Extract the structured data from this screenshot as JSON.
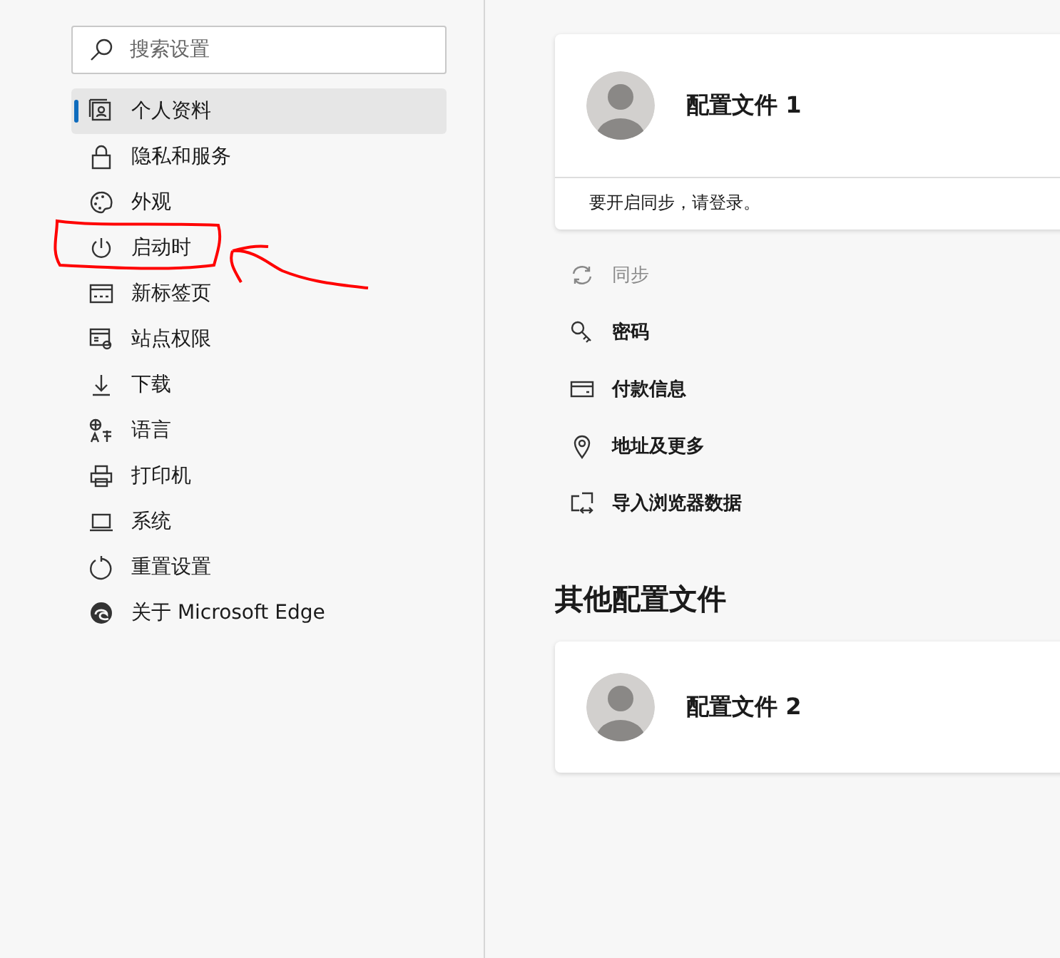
{
  "sidebar": {
    "search": {
      "placeholder": "搜索设置"
    },
    "items": [
      {
        "label": "个人资料",
        "selected": true
      },
      {
        "label": "隐私和服务",
        "selected": false
      },
      {
        "label": "外观",
        "selected": false
      },
      {
        "label": "启动时",
        "selected": false
      },
      {
        "label": "新标签页",
        "selected": false
      },
      {
        "label": "站点权限",
        "selected": false
      },
      {
        "label": "下载",
        "selected": false
      },
      {
        "label": "语言",
        "selected": false
      },
      {
        "label": "打印机",
        "selected": false
      },
      {
        "label": "系统",
        "selected": false
      },
      {
        "label": "重置设置",
        "selected": false
      },
      {
        "label": "关于 Microsoft Edge",
        "selected": false
      }
    ]
  },
  "current_profile": {
    "name": "配置文件 1",
    "footer": "要开启同步，请登录。"
  },
  "profile_options": [
    {
      "label": "同步",
      "disabled": true
    },
    {
      "label": "密码",
      "disabled": false
    },
    {
      "label": "付款信息",
      "disabled": false
    },
    {
      "label": "地址及更多",
      "disabled": false
    },
    {
      "label": "导入浏览器数据",
      "disabled": false
    }
  ],
  "other_profiles": {
    "title": "其他配置文件",
    "profiles": [
      {
        "name": "配置文件 2"
      }
    ]
  }
}
